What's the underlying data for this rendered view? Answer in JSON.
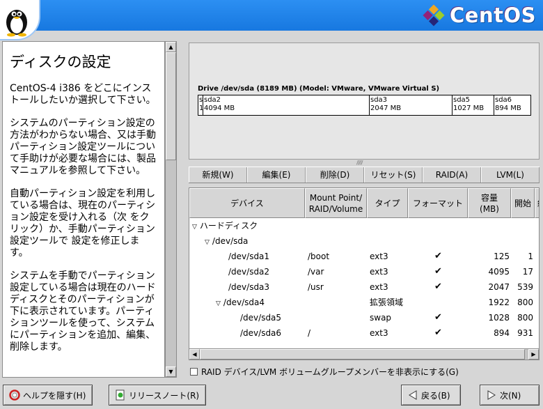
{
  "header": {
    "brand": "CentOS",
    "colors": {
      "bar": "#1e87ef",
      "brand_text": "#ffffff"
    }
  },
  "help": {
    "title": "ディスクの設定",
    "paragraphs": [
      "CentOS-4 i386 をどこにインストールしたいか選択して下さい。",
      "システムのパーティション設定の方法がわからない場合、又は手動パーティション設定ツールについて手助けが必要な場合には、製品マニュアルを参照して下さい。",
      "自動パーティション設定を利用している場合は、現在のパーティション設定を受け入れる（次 をクリック）か、手動パーティション設定ツールで 設定を修正します。",
      "システムを手動でパーティション設定している場合は現在のハードディスクとそのパーティションが下に表示されています。パーティションツールを使って、システムにパーティションを追加、編集、削除します。"
    ]
  },
  "drive": {
    "label": "Drive /dev/sda (8189 MB) (Model: VMware, VMware Virtual S)",
    "partitions": [
      {
        "name": "s",
        "size": "1"
      },
      {
        "name": "sda2",
        "size": "4094 MB"
      },
      {
        "name": "sda3",
        "size": "2047 MB"
      },
      {
        "name": "sda5",
        "size": "1027 MB"
      },
      {
        "name": "sda6",
        "size": "894 MB"
      }
    ]
  },
  "toolbar": {
    "new": "新規(W)",
    "edit": "編集(E)",
    "delete": "削除(D)",
    "reset": "リセット(S)",
    "raid": "RAID(A)",
    "lvm": "LVM(L)"
  },
  "table": {
    "headers": {
      "device": "デバイス",
      "mount_1": "Mount Point/",
      "mount_2": "RAID/Volume",
      "type": "タイプ",
      "format": "フォーマット",
      "size_1": "容量",
      "size_2": "(MB)",
      "start": "開始",
      "end": "終"
    },
    "groups": {
      "harddisk": "ハードディスク",
      "sda": "/dev/sda"
    },
    "rows": [
      {
        "device": "/dev/sda1",
        "mount": "/boot",
        "type": "ext3",
        "format": "✔",
        "size": "125",
        "start": "1"
      },
      {
        "device": "/dev/sda2",
        "mount": "/var",
        "type": "ext3",
        "format": "✔",
        "size": "4095",
        "start": "17"
      },
      {
        "device": "/dev/sda3",
        "mount": "/usr",
        "type": "ext3",
        "format": "✔",
        "size": "2047",
        "start": "539"
      },
      {
        "device": "/dev/sda4",
        "mount": "",
        "type": "拡張領域",
        "format": "",
        "size": "1922",
        "start": "800"
      },
      {
        "device": "/dev/sda5",
        "mount": "",
        "type": "swap",
        "format": "✔",
        "size": "1028",
        "start": "800"
      },
      {
        "device": "/dev/sda6",
        "mount": "/",
        "type": "ext3",
        "format": "✔",
        "size": "894",
        "start": "931"
      }
    ]
  },
  "raid_hide": "RAID デバイス/LVM ボリュームグループメンバーを非表示にする(G)",
  "buttons": {
    "hide_help": "ヘルプを隠す(H)",
    "release_notes": "リリースノート(R)",
    "back": "戻る(B)",
    "next": "次(N)"
  }
}
